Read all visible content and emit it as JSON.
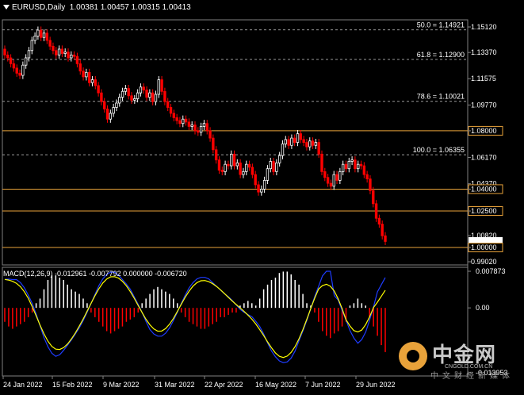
{
  "header": {
    "symbol_timeframe": "EURUSD,Daily",
    "ohlc": "1.00381 1.00457 1.00315 1.00413"
  },
  "macd": {
    "title": "MACD(12,26,9) -0.012961 -0.007792 0.000000 -0.006720",
    "axis_labels": [
      "0.007873",
      "0.00",
      "-0.013953"
    ]
  },
  "price_axis": {
    "ticks": [
      "1.15120",
      "1.13370",
      "1.11575",
      "1.09770",
      "1.08000",
      "1.06170",
      "1.04370",
      "1.04000",
      "1.02500",
      "1.00820",
      "1.00413",
      "1.00000",
      "0.99020"
    ]
  },
  "fib_levels": [
    {
      "label": "50.0 = 1.14921",
      "value": 1.14921
    },
    {
      "label": "61.8 = 1.12900",
      "value": 1.129
    },
    {
      "label": "78.6 = 1.10021",
      "value": 1.10021
    },
    {
      "label": "100.0 = 1.06355",
      "value": 1.06355
    }
  ],
  "horizontal_lines": [
    {
      "value": 1.08,
      "label": "1.08000"
    },
    {
      "value": 1.04,
      "label": "1.04000"
    },
    {
      "value": 1.025,
      "label": "1.02500"
    },
    {
      "value": 1.0,
      "label": "1.00000"
    }
  ],
  "current_price": "1.00413",
  "time_axis": [
    "24 Jan 2022",
    "15 Feb 2022",
    "9 Mar 2022",
    "31 Mar 2022",
    "22 Apr 2022",
    "16 May 2022",
    "7 Jun 2022",
    "29 Jun 2022"
  ],
  "watermark": {
    "logo_text": "中金网",
    "url": "CNGOLD.COM.CN",
    "sub": "中文财经新媒体"
  },
  "colors": {
    "bull": "#ffffff",
    "bear": "#ff0000",
    "grid": "#7f7f7f",
    "hline": "#e8a23a",
    "macd_signal": "#ffff00",
    "macd_line": "#1e3cff",
    "hist_pos": "#ffffff",
    "hist_neg": "#ff0000"
  },
  "chart_data": {
    "type": "candlestick",
    "ylim": [
      0.9902,
      1.1512
    ],
    "closes": [
      1.132,
      1.13,
      1.126,
      1.123,
      1.1195,
      1.118,
      1.125,
      1.13,
      1.135,
      1.142,
      1.145,
      1.149,
      1.144,
      1.147,
      1.142,
      1.138,
      1.135,
      1.132,
      1.136,
      1.133,
      1.134,
      1.13,
      1.132,
      1.131,
      1.126,
      1.121,
      1.117,
      1.12,
      1.113,
      1.115,
      1.111,
      1.106,
      1.1,
      1.095,
      1.088,
      1.092,
      1.096,
      1.099,
      1.103,
      1.107,
      1.109,
      1.104,
      1.101,
      1.102,
      1.106,
      1.11,
      1.108,
      1.103,
      1.106,
      1.1,
      1.105,
      1.115,
      1.107,
      1.1,
      1.096,
      1.092,
      1.089,
      1.087,
      1.085,
      1.088,
      1.086,
      1.083,
      1.084,
      1.08,
      1.079,
      1.083,
      1.085,
      1.08,
      1.075,
      1.067,
      1.06,
      1.053,
      1.052,
      1.057,
      1.056,
      1.064,
      1.056,
      1.058,
      1.05,
      1.052,
      1.057,
      1.055,
      1.05,
      1.043,
      1.038,
      1.04,
      1.046,
      1.054,
      1.059,
      1.052,
      1.058,
      1.063,
      1.071,
      1.074,
      1.07,
      1.075,
      1.072,
      1.078,
      1.074,
      1.072,
      1.069,
      1.073,
      1.07,
      1.072,
      1.064,
      1.052,
      1.048,
      1.044,
      1.042,
      1.05,
      1.046,
      1.052,
      1.057,
      1.054,
      1.059,
      1.06,
      1.054,
      1.057,
      1.056,
      1.05,
      1.047,
      1.039,
      1.03,
      1.02,
      1.016,
      1.008,
      1.0041
    ],
    "macd_hist": [
      -0.003,
      -0.004,
      -0.0045,
      -0.004,
      -0.0035,
      -0.003,
      -0.002,
      -0.001,
      0.001,
      0.002,
      0.004,
      0.006,
      0.007,
      0.007,
      0.0065,
      0.006,
      0.005,
      0.004,
      0.0035,
      0.003,
      0.002,
      0.001,
      -0.001,
      -0.002,
      -0.003,
      -0.004,
      -0.005,
      -0.0055,
      -0.005,
      -0.0045,
      -0.004,
      -0.003,
      -0.0025,
      -0.002,
      -0.001,
      0.001,
      0.002,
      0.003,
      0.004,
      0.0045,
      0.004,
      0.0035,
      0.003,
      0.002,
      0.001,
      -0.001,
      -0.002,
      -0.003,
      -0.0035,
      -0.004,
      -0.0045,
      -0.0045,
      -0.004,
      -0.0035,
      -0.003,
      -0.002,
      -0.002,
      -0.0015,
      -0.001,
      -0.001,
      0.0005,
      0.001,
      0.0015,
      0.001,
      0.0005,
      0.002,
      0.004,
      0.005,
      0.006,
      0.0065,
      0.0075,
      0.0078,
      0.0078,
      0.0072,
      0.006,
      0.005,
      0.003,
      0.001,
      0.0005,
      -0.001,
      -0.003,
      -0.005,
      -0.006,
      -0.0065,
      -0.0055,
      -0.005,
      -0.004,
      -0.003,
      0.0005,
      0.001,
      0.002,
      0.001,
      0.0005,
      -0.002,
      -0.004,
      -0.006,
      -0.008,
      -0.0095
    ]
  }
}
